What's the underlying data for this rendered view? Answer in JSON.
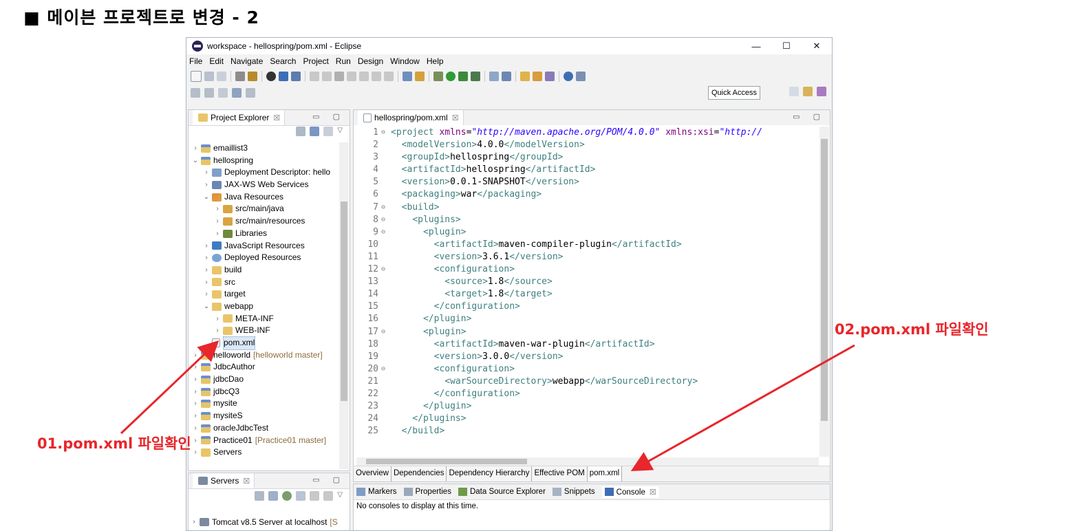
{
  "slide_title": "■ 메이븐 프로젝트로 변경 - 2",
  "window": {
    "title": "workspace - hellospring/pom.xml - Eclipse",
    "controls": [
      "—",
      "☐",
      "✕"
    ]
  },
  "menu": [
    "File",
    "Edit",
    "Navigate",
    "Search",
    "Project",
    "Run",
    "Design",
    "Window",
    "Help"
  ],
  "quick_access": "Quick Access",
  "project_explorer": {
    "tab_label": "Project Explorer",
    "close": "☒",
    "items": [
      {
        "label": "emaillist3",
        "twisty": "›",
        "icon": "project-icon",
        "indent": 0
      },
      {
        "label": "hellospring",
        "twisty": "⌄",
        "icon": "project-icon",
        "indent": 0
      },
      {
        "label": "Deployment Descriptor: hello",
        "twisty": "›",
        "icon": "deployment-descriptor-icon",
        "indent": 1
      },
      {
        "label": "JAX-WS Web Services",
        "twisty": "›",
        "icon": "web-services-icon",
        "indent": 1
      },
      {
        "label": "Java Resources",
        "twisty": "⌄",
        "icon": "java-resources-icon",
        "indent": 1
      },
      {
        "label": "src/main/java",
        "twisty": "›",
        "icon": "package-folder-icon",
        "indent": 2
      },
      {
        "label": "src/main/resources",
        "twisty": "›",
        "icon": "package-folder-icon",
        "indent": 2
      },
      {
        "label": "Libraries",
        "twisty": "›",
        "icon": "library-icon",
        "indent": 2
      },
      {
        "label": "JavaScript Resources",
        "twisty": "›",
        "icon": "javascript-icon",
        "indent": 1
      },
      {
        "label": "Deployed Resources",
        "twisty": "›",
        "icon": "deployed-resources-icon",
        "indent": 1
      },
      {
        "label": "build",
        "twisty": "›",
        "icon": "folder-icon",
        "indent": 1
      },
      {
        "label": "src",
        "twisty": "›",
        "icon": "folder-icon",
        "indent": 1
      },
      {
        "label": "target",
        "twisty": "›",
        "icon": "folder-icon",
        "indent": 1
      },
      {
        "label": "webapp",
        "twisty": "⌄",
        "icon": "folder-icon",
        "indent": 1
      },
      {
        "label": "META-INF",
        "twisty": "›",
        "icon": "folder-icon",
        "indent": 2
      },
      {
        "label": "WEB-INF",
        "twisty": "›",
        "icon": "folder-icon",
        "indent": 2
      },
      {
        "label": "pom.xml",
        "twisty": "",
        "icon": "xml-file-icon",
        "indent": 1,
        "selected": true
      },
      {
        "label": "helloworld",
        "decoration": "[helloworld master]",
        "twisty": "›",
        "icon": "project-icon",
        "indent": 0
      },
      {
        "label": "JdbcAuthor",
        "twisty": "›",
        "icon": "project-icon",
        "indent": 0
      },
      {
        "label": "jdbcDao",
        "twisty": "›",
        "icon": "project-icon",
        "indent": 0
      },
      {
        "label": "jdbcQ3",
        "twisty": "›",
        "icon": "project-icon",
        "indent": 0
      },
      {
        "label": "mysite",
        "twisty": "›",
        "icon": "project-icon",
        "indent": 0
      },
      {
        "label": "mysiteS",
        "twisty": "›",
        "icon": "project-icon",
        "indent": 0
      },
      {
        "label": "oracleJdbcTest",
        "twisty": "›",
        "icon": "project-icon",
        "indent": 0
      },
      {
        "label": "Practice01",
        "decoration": "[Practice01 master]",
        "twisty": "›",
        "icon": "project-icon",
        "indent": 0
      },
      {
        "label": "Servers",
        "twisty": "›",
        "icon": "folder-icon",
        "indent": 0
      }
    ]
  },
  "servers_view": {
    "tab_label": "Servers",
    "close": "☒",
    "item": "Tomcat v8.5 Server at localhost",
    "item_suffix": "[S"
  },
  "editor": {
    "tab_label": "hellospring/pom.xml",
    "close": "☒",
    "lines": [
      {
        "n": "1",
        "fold": "⊖",
        "html": "<span class='tag'>&lt;project</span> <span class='attr'>xmlns</span>=<span class='str'>\"http://maven.apache.org/POM/4.0.0\"</span> <span class='attr'>xmlns:xsi</span>=<span class='str'>\"http://</span>"
      },
      {
        "n": "2",
        "fold": "",
        "text": "  <modelVersion>4.0.0</modelVersion>"
      },
      {
        "n": "3",
        "fold": "",
        "text": "  <groupId>hellospring</groupId>"
      },
      {
        "n": "4",
        "fold": "",
        "text": "  <artifactId>hellospring</artifactId>"
      },
      {
        "n": "5",
        "fold": "",
        "text": "  <version>0.0.1-SNAPSHOT</version>"
      },
      {
        "n": "6",
        "fold": "",
        "text": "  <packaging>war</packaging>"
      },
      {
        "n": "7",
        "fold": "⊖",
        "text": "  <build>"
      },
      {
        "n": "8",
        "fold": "⊖",
        "text": "    <plugins>"
      },
      {
        "n": "9",
        "fold": "⊖",
        "text": "      <plugin>"
      },
      {
        "n": "10",
        "fold": "",
        "text": "        <artifactId>maven-compiler-plugin</artifactId>"
      },
      {
        "n": "11",
        "fold": "",
        "text": "        <version>3.6.1</version>"
      },
      {
        "n": "12",
        "fold": "⊖",
        "text": "        <configuration>"
      },
      {
        "n": "13",
        "fold": "",
        "text": "          <source>1.8</source>"
      },
      {
        "n": "14",
        "fold": "",
        "text": "          <target>1.8</target>"
      },
      {
        "n": "15",
        "fold": "",
        "text": "        </configuration>"
      },
      {
        "n": "16",
        "fold": "",
        "text": "      </plugin>"
      },
      {
        "n": "17",
        "fold": "⊖",
        "text": "      <plugin>"
      },
      {
        "n": "18",
        "fold": "",
        "text": "        <artifactId>maven-war-plugin</artifactId>"
      },
      {
        "n": "19",
        "fold": "",
        "text": "        <version>3.0.0</version>"
      },
      {
        "n": "20",
        "fold": "⊖",
        "text": "        <configuration>"
      },
      {
        "n": "21",
        "fold": "",
        "text": "          <warSourceDirectory>webapp</warSourceDirectory>"
      },
      {
        "n": "22",
        "fold": "",
        "text": "        </configuration>"
      },
      {
        "n": "23",
        "fold": "",
        "text": "      </plugin>"
      },
      {
        "n": "24",
        "fold": "",
        "text": "    </plugins>"
      },
      {
        "n": "25",
        "fold": "",
        "text": "  </build>"
      }
    ],
    "pom_tabs": [
      "Overview",
      "Dependencies",
      "Dependency Hierarchy",
      "Effective POM",
      "pom.xml"
    ],
    "active_pom_tab": "pom.xml"
  },
  "bottom_panel": {
    "tabs": [
      "Markers",
      "Properties",
      "Data Source Explorer",
      "Snippets",
      "Console"
    ],
    "active_tab": "Console",
    "close": "☒",
    "message": "No consoles to display at this time."
  },
  "callouts": {
    "first": "01.pom.xml 파일확인",
    "second": "02.pom.xml 파일확인",
    "color": "#e8262b"
  }
}
